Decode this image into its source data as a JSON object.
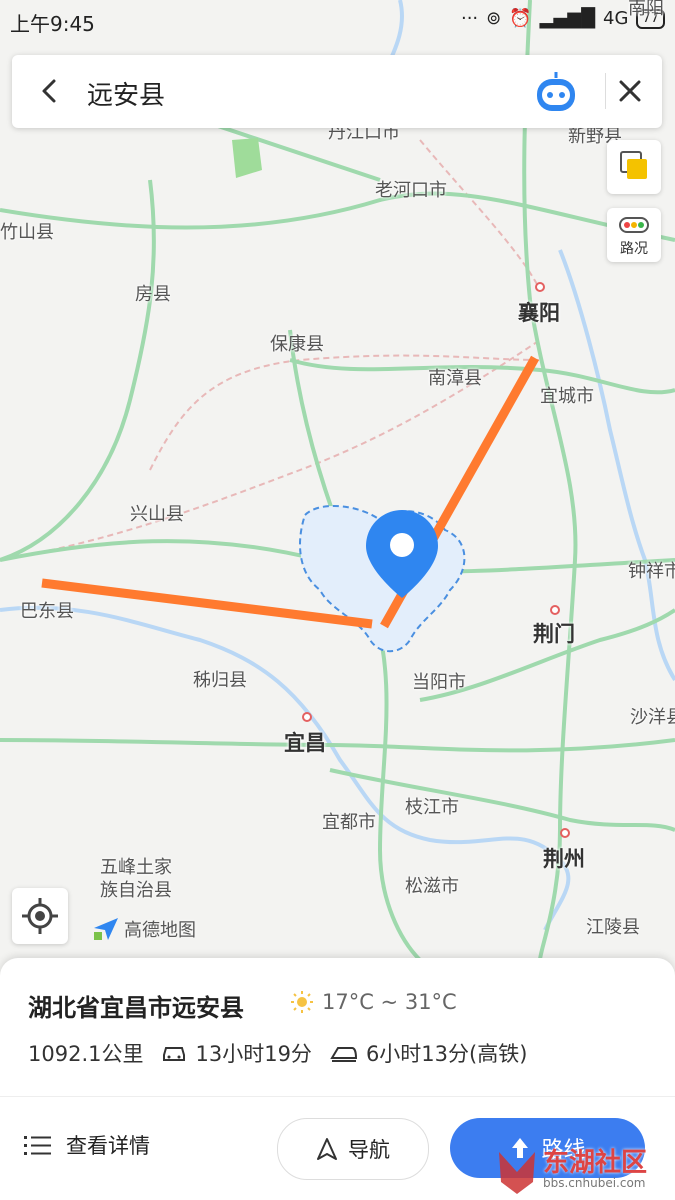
{
  "status_bar": {
    "time": "上午9:45",
    "network": "4G",
    "battery": "77",
    "edge_label": "南阳"
  },
  "search": {
    "query": "远安县"
  },
  "side_buttons": {
    "traffic_label": "路况"
  },
  "map": {
    "labels": [
      "丹江口市",
      "老河口市",
      "新野县",
      "竹山县",
      "房县",
      "襄阳",
      "保康县",
      "南漳县",
      "宜城市",
      "兴山县",
      "钟祥市",
      "巴东县",
      "荆门",
      "秭归县",
      "当阳市",
      "沙洋县",
      "宜昌",
      "枝江市",
      "宜都市",
      "荆州",
      "五峰土家",
      "族自治县",
      "松滋市",
      "江陵县"
    ],
    "logo_text": "高德地图"
  },
  "place": {
    "title": "湖北省宜昌市远安县",
    "weather": "17°C ~ 31°C",
    "distance": "1092.1公里",
    "drive_time": "13小时19分",
    "train_time": "6小时13分(高铁)"
  },
  "actions": {
    "details": "查看详情",
    "navigate": "导航",
    "route": "路线"
  },
  "watermark": {
    "text": "东湖社区",
    "url": "bbs.cnhubei.com"
  },
  "colors": {
    "accent": "#3c7df0",
    "marker": "#2f86f0",
    "annotation": "#ff7a2f",
    "road": "#8fd6a0"
  }
}
